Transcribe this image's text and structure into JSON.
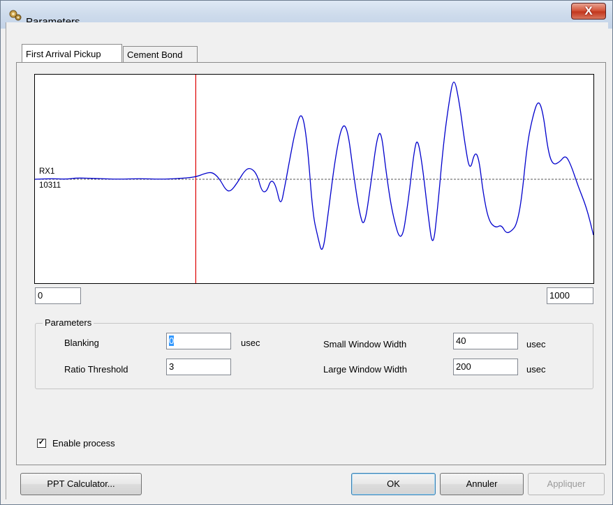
{
  "window": {
    "title": "Parameters...",
    "title_icon": "gear-icon",
    "close_label": "X"
  },
  "tabs": [
    {
      "label": "First Arrival Pickup",
      "active": true
    },
    {
      "label": "Cement Bond",
      "active": false
    }
  ],
  "plot": {
    "channel_name": "RX1",
    "channel_value": "10311",
    "x_min": "0",
    "x_max": "1000",
    "waveform_color": "#0000cc",
    "marker_color": "#dd0000",
    "marker_time": 288
  },
  "parameters": {
    "group_title": "Parameters",
    "blanking_label": "Blanking",
    "blanking_value": "0",
    "blanking_unit": "usec",
    "ratio_label": "Ratio Threshold",
    "ratio_value": "3",
    "small_label": "Small Window Width",
    "small_value": "40",
    "small_unit": "usec",
    "large_label": "Large  Window Width",
    "large_value": "200",
    "large_unit": "usec"
  },
  "enable_process": {
    "label": "Enable process",
    "checked": true
  },
  "buttons": {
    "ppt": "PPT Calculator...",
    "ok": "OK",
    "cancel": "Annuler",
    "apply": "Appliquer"
  }
}
